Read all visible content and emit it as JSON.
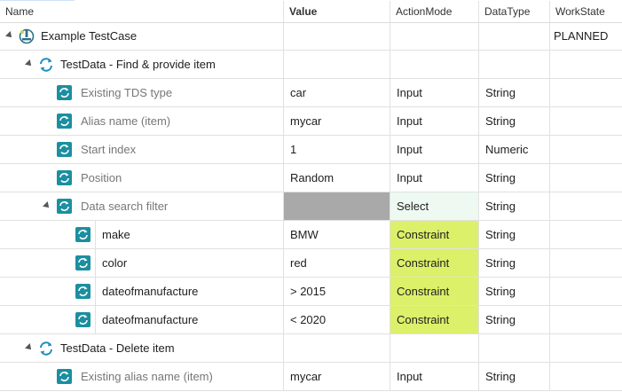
{
  "header": {
    "name": "Name",
    "value": "Value",
    "action_mode": "ActionMode",
    "data_type": "DataType",
    "work_state": "WorkState"
  },
  "rows": [
    {
      "name": "Example TestCase",
      "value": "",
      "mode": "",
      "type": "",
      "state": "PLANNED",
      "kind": "testcase"
    },
    {
      "name": "TestData - Find & provide item",
      "value": "",
      "mode": "",
      "type": "",
      "state": "",
      "kind": "testdata"
    },
    {
      "name": "Existing TDS type",
      "value": "car",
      "mode": "Input",
      "type": "String",
      "state": "",
      "kind": "attr"
    },
    {
      "name": "Alias name (item)",
      "value": "mycar",
      "mode": "Input",
      "type": "String",
      "state": "",
      "kind": "attr"
    },
    {
      "name": "Start index",
      "value": "1",
      "mode": "Input",
      "type": "Numeric",
      "state": "",
      "kind": "attr"
    },
    {
      "name": "Position",
      "value": "Random",
      "mode": "Input",
      "type": "String",
      "state": "",
      "kind": "attr"
    },
    {
      "name": "Data search filter",
      "value": "",
      "mode": "Select",
      "type": "String",
      "state": "",
      "kind": "attr-parent"
    },
    {
      "name": "make",
      "value": "BMW",
      "mode": "Constraint",
      "type": "String",
      "state": "",
      "kind": "sub"
    },
    {
      "name": "color",
      "value": "red",
      "mode": "Constraint",
      "type": "String",
      "state": "",
      "kind": "sub"
    },
    {
      "name": "dateofmanufacture",
      "value": "> 2015",
      "mode": "Constraint",
      "type": "String",
      "state": "",
      "kind": "sub"
    },
    {
      "name": "dateofmanufacture",
      "value": "< 2020",
      "mode": "Constraint",
      "type": "String",
      "state": "",
      "kind": "sub"
    },
    {
      "name": "TestData - Delete item",
      "value": "",
      "mode": "",
      "type": "",
      "state": "",
      "kind": "testdata"
    },
    {
      "name": "Existing alias name (item)",
      "value": "mycar",
      "mode": "Input",
      "type": "String",
      "state": "",
      "kind": "attr"
    }
  ],
  "colors": {
    "constraint_bg": "#dcf06a",
    "select_bg": "#eefaf1",
    "value_disabled_bg": "#a9a9a9",
    "icon_teal": "#1b8fa0"
  },
  "icons": {
    "testcase": "testcase-icon",
    "testdata": "sync-icon",
    "attribute": "refresh-square-icon",
    "expander": "collapse-triangle-icon"
  }
}
